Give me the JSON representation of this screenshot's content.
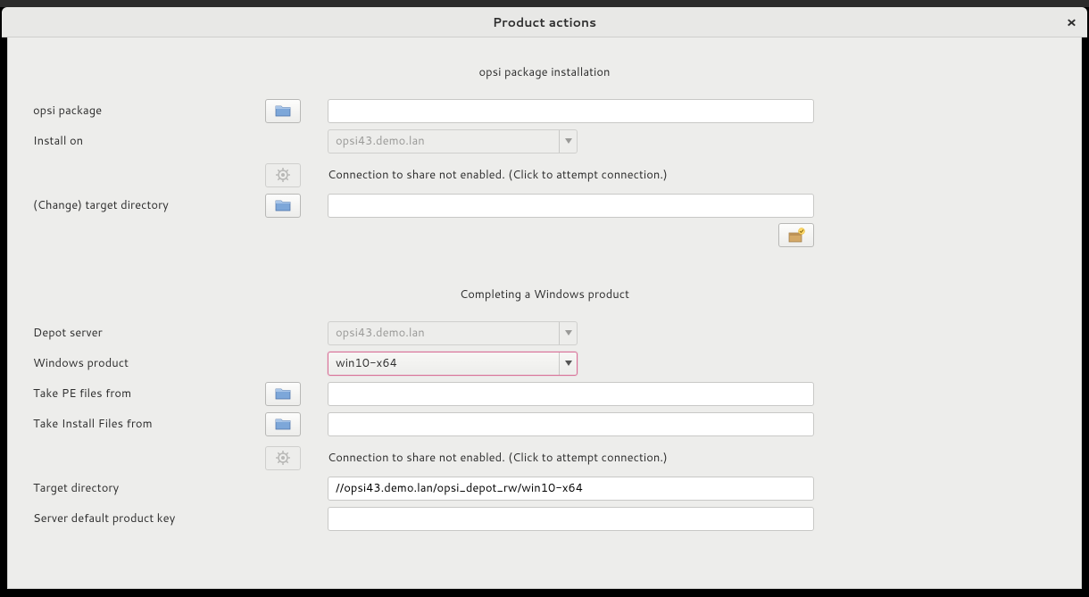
{
  "titlebar": {
    "title": "Product actions"
  },
  "section1": {
    "title": "opsi package installation",
    "opsi_package_label": "opsi package",
    "opsi_package_value": "",
    "install_on_label": "Install on",
    "install_on_value": "opsi43.demo.lan",
    "connection_text": "Connection to share not enabled. (Click to attempt connection.)",
    "change_target_label": "(Change) target directory",
    "change_target_value": ""
  },
  "section2": {
    "title": "Completing a Windows product",
    "depot_server_label": "Depot server",
    "depot_server_value": "opsi43.demo.lan",
    "windows_product_label": "Windows product",
    "windows_product_value": "win10-x64",
    "take_pe_label": "Take PE files from",
    "take_pe_value": "",
    "take_install_label": "Take Install Files from",
    "take_install_value": "",
    "connection_text": "Connection to share not enabled. (Click to attempt connection.)",
    "target_dir_label": "Target directory",
    "target_dir_value": "//opsi43.demo.lan/opsi_depot_rw/win10-x64",
    "product_key_label": "Server default product key",
    "product_key_value": ""
  }
}
